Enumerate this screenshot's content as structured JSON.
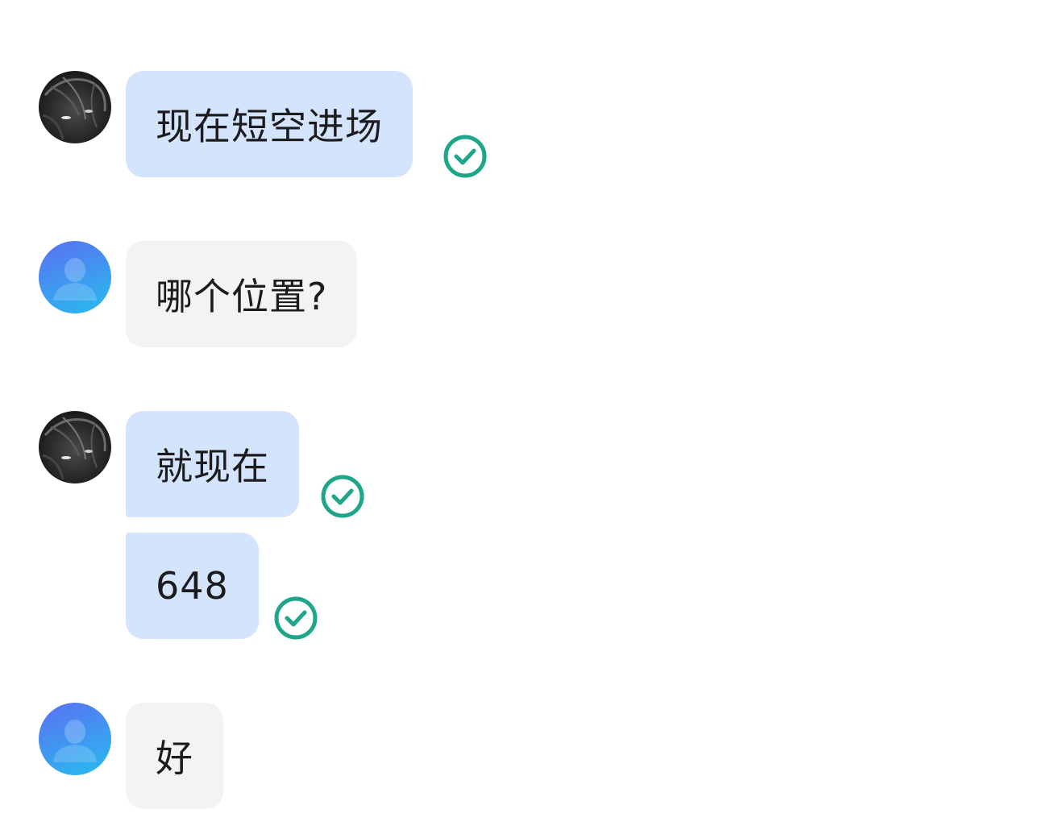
{
  "messages": [
    {
      "sender": "self",
      "text": "现在短空进场",
      "status": "read"
    },
    {
      "sender": "other",
      "text": "哪个位置?"
    },
    {
      "sender": "self",
      "text": "就现在",
      "status": "read"
    },
    {
      "sender": "self",
      "text": "648",
      "status": "read"
    },
    {
      "sender": "other",
      "text": "好"
    }
  ],
  "icons": {
    "self_avatar": "dark-anime-character-avatar",
    "other_avatar": "default-user-silhouette-avatar",
    "read_status": "check-circle-icon"
  },
  "colors": {
    "self_bubble": "#d3e4fc",
    "other_bubble": "#f2f3f5",
    "read_check": "#1fa58a",
    "default_avatar_top": "#5b6ff2",
    "default_avatar_bottom": "#2fb0ef"
  }
}
